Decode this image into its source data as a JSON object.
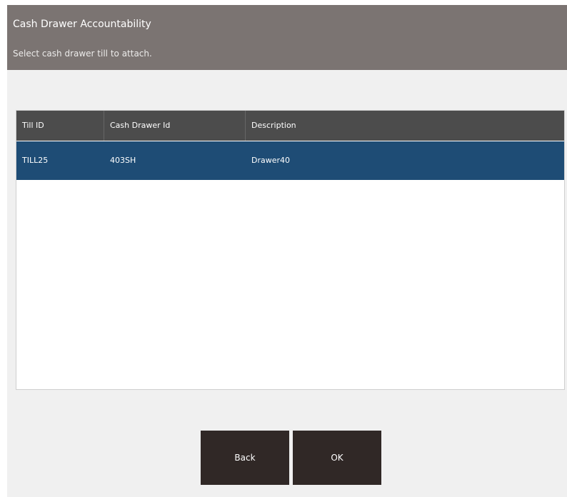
{
  "header": {
    "title": "Cash Drawer Accountability",
    "subtitle": "Select cash drawer till to attach."
  },
  "table": {
    "columns": [
      "Till ID",
      "Cash Drawer Id",
      "Description"
    ],
    "rows": [
      {
        "till_id": "TILL25",
        "cash_drawer_id": "403SH",
        "description": "Drawer40"
      }
    ]
  },
  "buttons": {
    "back": "Back",
    "ok": "OK"
  },
  "colors": {
    "header_bg": "#7b7472",
    "table_header_bg": "#4c4c4c",
    "selected_row_bg": "#1e4c75",
    "button_bg": "#302826"
  }
}
